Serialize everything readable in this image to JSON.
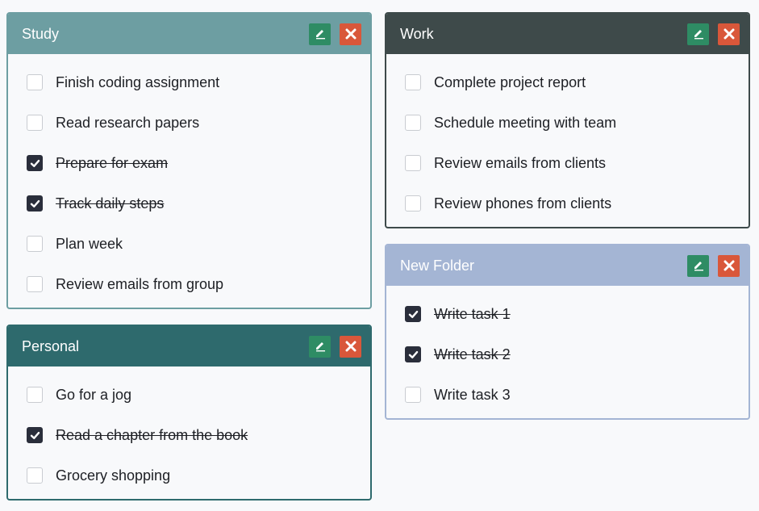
{
  "folders": [
    {
      "id": "study",
      "title": "Study",
      "header_color": "#6d9ea2",
      "border_color": "#6d9ea2",
      "tasks": [
        {
          "label": "Finish coding assignment",
          "done": false
        },
        {
          "label": "Read research papers",
          "done": false
        },
        {
          "label": "Prepare for exam",
          "done": true
        },
        {
          "label": "Track daily steps",
          "done": true
        },
        {
          "label": "Plan week",
          "done": false
        },
        {
          "label": "Review emails from group",
          "done": false
        }
      ]
    },
    {
      "id": "personal",
      "title": "Personal",
      "header_color": "#2e6a6d",
      "border_color": "#2e6a6d",
      "tasks": [
        {
          "label": "Go for a jog",
          "done": false
        },
        {
          "label": "Read a chapter from the book",
          "done": true
        },
        {
          "label": "Grocery shopping",
          "done": false
        }
      ]
    },
    {
      "id": "work",
      "title": "Work",
      "header_color": "#3e4a4a",
      "border_color": "#3e4a4a",
      "tasks": [
        {
          "label": "Complete project report",
          "done": false
        },
        {
          "label": "Schedule meeting with team",
          "done": false
        },
        {
          "label": "Review emails from clients",
          "done": false
        },
        {
          "label": "Review phones from clients",
          "done": false
        }
      ]
    },
    {
      "id": "new-folder",
      "title": "New Folder",
      "header_color": "#a4b5d4",
      "border_color": "#a4b5d4",
      "tasks": [
        {
          "label": "Write task 1",
          "done": true
        },
        {
          "label": "Write task 2",
          "done": true
        },
        {
          "label": "Write task 3",
          "done": false
        }
      ]
    }
  ],
  "icons": {
    "edit": "pencil-icon",
    "delete": "close-icon",
    "checked": "checkmark-icon"
  }
}
